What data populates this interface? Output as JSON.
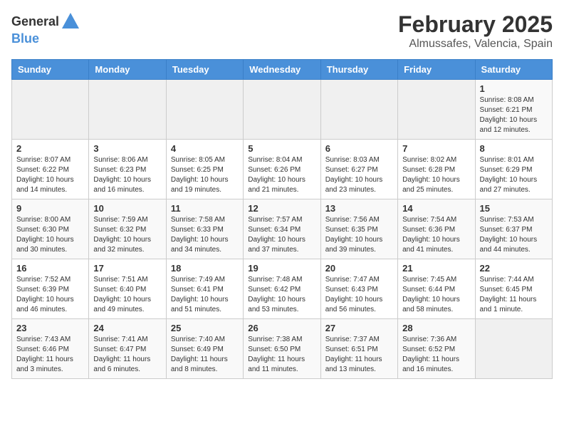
{
  "logo": {
    "general": "General",
    "blue": "Blue"
  },
  "title": "February 2025",
  "subtitle": "Almussafes, Valencia, Spain",
  "days_of_week": [
    "Sunday",
    "Monday",
    "Tuesday",
    "Wednesday",
    "Thursday",
    "Friday",
    "Saturday"
  ],
  "weeks": [
    [
      {
        "day": "",
        "info": ""
      },
      {
        "day": "",
        "info": ""
      },
      {
        "day": "",
        "info": ""
      },
      {
        "day": "",
        "info": ""
      },
      {
        "day": "",
        "info": ""
      },
      {
        "day": "",
        "info": ""
      },
      {
        "day": "1",
        "info": "Sunrise: 8:08 AM\nSunset: 6:21 PM\nDaylight: 10 hours and 12 minutes."
      }
    ],
    [
      {
        "day": "2",
        "info": "Sunrise: 8:07 AM\nSunset: 6:22 PM\nDaylight: 10 hours and 14 minutes."
      },
      {
        "day": "3",
        "info": "Sunrise: 8:06 AM\nSunset: 6:23 PM\nDaylight: 10 hours and 16 minutes."
      },
      {
        "day": "4",
        "info": "Sunrise: 8:05 AM\nSunset: 6:25 PM\nDaylight: 10 hours and 19 minutes."
      },
      {
        "day": "5",
        "info": "Sunrise: 8:04 AM\nSunset: 6:26 PM\nDaylight: 10 hours and 21 minutes."
      },
      {
        "day": "6",
        "info": "Sunrise: 8:03 AM\nSunset: 6:27 PM\nDaylight: 10 hours and 23 minutes."
      },
      {
        "day": "7",
        "info": "Sunrise: 8:02 AM\nSunset: 6:28 PM\nDaylight: 10 hours and 25 minutes."
      },
      {
        "day": "8",
        "info": "Sunrise: 8:01 AM\nSunset: 6:29 PM\nDaylight: 10 hours and 27 minutes."
      }
    ],
    [
      {
        "day": "9",
        "info": "Sunrise: 8:00 AM\nSunset: 6:30 PM\nDaylight: 10 hours and 30 minutes."
      },
      {
        "day": "10",
        "info": "Sunrise: 7:59 AM\nSunset: 6:32 PM\nDaylight: 10 hours and 32 minutes."
      },
      {
        "day": "11",
        "info": "Sunrise: 7:58 AM\nSunset: 6:33 PM\nDaylight: 10 hours and 34 minutes."
      },
      {
        "day": "12",
        "info": "Sunrise: 7:57 AM\nSunset: 6:34 PM\nDaylight: 10 hours and 37 minutes."
      },
      {
        "day": "13",
        "info": "Sunrise: 7:56 AM\nSunset: 6:35 PM\nDaylight: 10 hours and 39 minutes."
      },
      {
        "day": "14",
        "info": "Sunrise: 7:54 AM\nSunset: 6:36 PM\nDaylight: 10 hours and 41 minutes."
      },
      {
        "day": "15",
        "info": "Sunrise: 7:53 AM\nSunset: 6:37 PM\nDaylight: 10 hours and 44 minutes."
      }
    ],
    [
      {
        "day": "16",
        "info": "Sunrise: 7:52 AM\nSunset: 6:39 PM\nDaylight: 10 hours and 46 minutes."
      },
      {
        "day": "17",
        "info": "Sunrise: 7:51 AM\nSunset: 6:40 PM\nDaylight: 10 hours and 49 minutes."
      },
      {
        "day": "18",
        "info": "Sunrise: 7:49 AM\nSunset: 6:41 PM\nDaylight: 10 hours and 51 minutes."
      },
      {
        "day": "19",
        "info": "Sunrise: 7:48 AM\nSunset: 6:42 PM\nDaylight: 10 hours and 53 minutes."
      },
      {
        "day": "20",
        "info": "Sunrise: 7:47 AM\nSunset: 6:43 PM\nDaylight: 10 hours and 56 minutes."
      },
      {
        "day": "21",
        "info": "Sunrise: 7:45 AM\nSunset: 6:44 PM\nDaylight: 10 hours and 58 minutes."
      },
      {
        "day": "22",
        "info": "Sunrise: 7:44 AM\nSunset: 6:45 PM\nDaylight: 11 hours and 1 minute."
      }
    ],
    [
      {
        "day": "23",
        "info": "Sunrise: 7:43 AM\nSunset: 6:46 PM\nDaylight: 11 hours and 3 minutes."
      },
      {
        "day": "24",
        "info": "Sunrise: 7:41 AM\nSunset: 6:47 PM\nDaylight: 11 hours and 6 minutes."
      },
      {
        "day": "25",
        "info": "Sunrise: 7:40 AM\nSunset: 6:49 PM\nDaylight: 11 hours and 8 minutes."
      },
      {
        "day": "26",
        "info": "Sunrise: 7:38 AM\nSunset: 6:50 PM\nDaylight: 11 hours and 11 minutes."
      },
      {
        "day": "27",
        "info": "Sunrise: 7:37 AM\nSunset: 6:51 PM\nDaylight: 11 hours and 13 minutes."
      },
      {
        "day": "28",
        "info": "Sunrise: 7:36 AM\nSunset: 6:52 PM\nDaylight: 11 hours and 16 minutes."
      },
      {
        "day": "",
        "info": ""
      }
    ]
  ]
}
